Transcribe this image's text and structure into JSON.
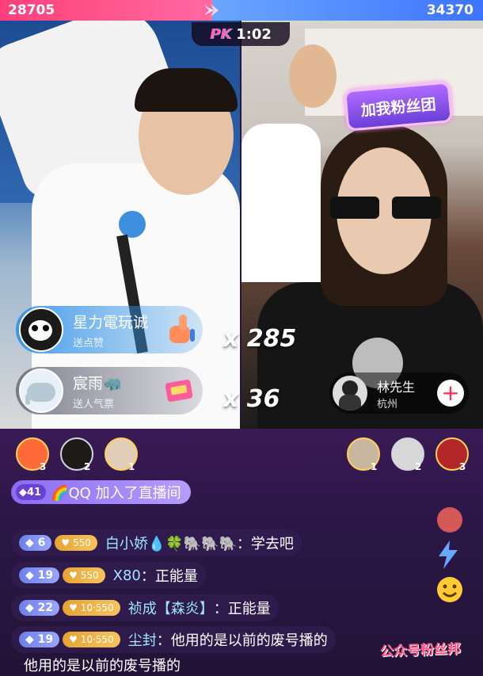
{
  "pk": {
    "left_score": "28705",
    "right_score": "34370",
    "logo": "PK",
    "timer": "1:02"
  },
  "sticker": {
    "text": "加我粉丝团"
  },
  "gifts": [
    {
      "name": "星力電玩诚",
      "sub": "送点赞",
      "combo": "x 285"
    },
    {
      "name": "宸雨🦏",
      "sub": "送人气票",
      "combo": "x 36"
    }
  ],
  "opponent": {
    "name": "林先生",
    "city": "杭州",
    "add": "+"
  },
  "fans_left": [
    {
      "rank": "3"
    },
    {
      "rank": "2"
    },
    {
      "rank": "1"
    }
  ],
  "fans_right": [
    {
      "rank": "1"
    },
    {
      "rank": "2"
    },
    {
      "rank": "3"
    }
  ],
  "join": {
    "level": "41",
    "text": "🌈QQ 加入了直播间"
  },
  "chat": [
    {
      "level": "6",
      "fan": "550",
      "user": "白小娇",
      "msg": "💧🍀🐘🐘🐘：学去吧",
      "user_color": "#9fe6ff"
    },
    {
      "level": "19",
      "fan": "550",
      "user": "X80",
      "msg": "：正能量",
      "user_color": "#9fe6ff"
    },
    {
      "level": "22",
      "fan": "10·550",
      "user": "祯成【森炎】",
      "msg": "：正能量",
      "user_color": "#9fe6ff"
    },
    {
      "level": "19",
      "fan": "10·550",
      "user": "尘封",
      "msg": "：他用的是以前的废号播的",
      "user_color": "#9fe6ff"
    }
  ],
  "chat_overflow": "他用的是以前的废号播的",
  "watermark": "公众号粉丝邦",
  "colors": {
    "pk_red": "#ff3f7a",
    "pk_blue": "#3d74ff",
    "accent_purple": "#8a6cf2"
  },
  "icons": [
    "spark-icon",
    "plus-icon",
    "like-hand-icon",
    "emoji-icon",
    "lightning-icon",
    "diamond-icon"
  ]
}
